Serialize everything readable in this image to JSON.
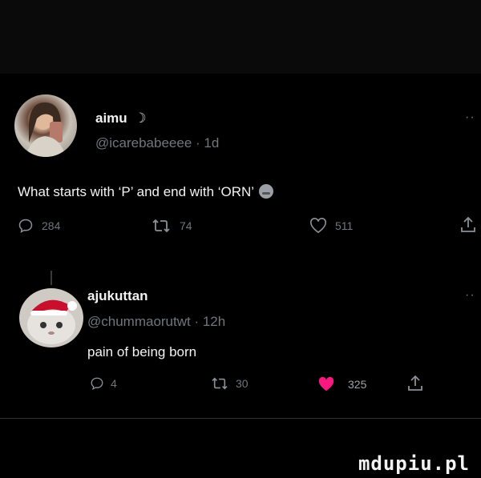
{
  "tweet1": {
    "name": "aimu",
    "name_badge": "☽",
    "handle": "@icarebabeeee · 1d",
    "text": "What starts with ‘P’ and end with ‘ORN’",
    "replies": "284",
    "retweets": "74",
    "likes": "511",
    "more": "··"
  },
  "tweet2": {
    "name": "ajukuttan",
    "handle": "@chummaorutwt · 12h",
    "text": "pain of being born",
    "replies": "4",
    "retweets": "30",
    "likes": "325",
    "more": "··"
  },
  "colors": {
    "background": "#000000",
    "secondary_text": "#71767b",
    "like_active": "#f91880"
  },
  "watermark": "mdupiu.pl"
}
